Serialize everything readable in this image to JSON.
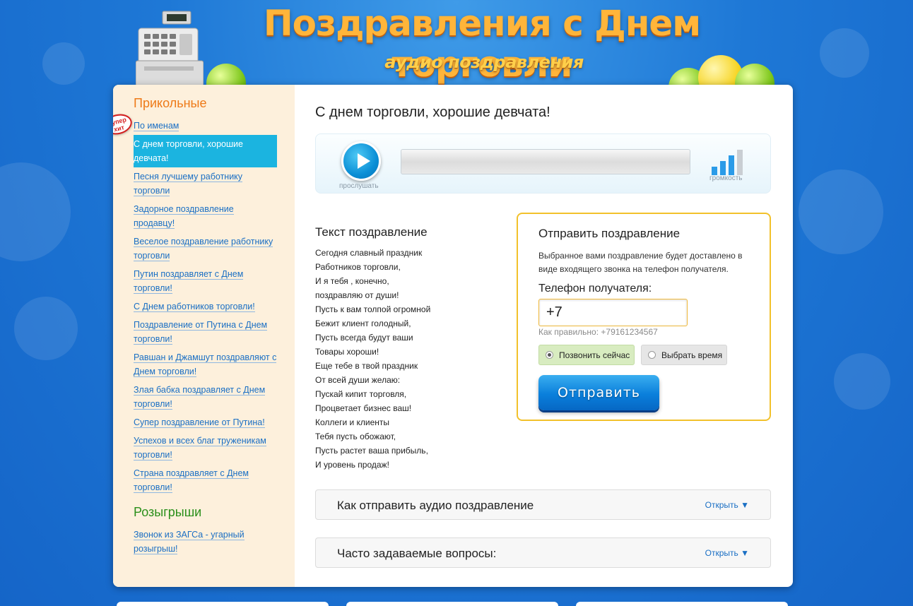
{
  "header": {
    "title": "Поздравления с Днем торговли",
    "subtitle": "аудио поздравления"
  },
  "sidebar": {
    "badge": "супер хит",
    "section1_title": "Прикольные",
    "items": [
      {
        "label": "По именам"
      },
      {
        "label": "С днем торговли, хорошие девчата!",
        "active": true
      },
      {
        "label": "Песня лучшему работнику торговли"
      },
      {
        "label": "Задорное поздравление продавцу!"
      },
      {
        "label": "Веселое поздравление работнику торговли"
      },
      {
        "label": "Путин поздравляет с Днем торговли!"
      },
      {
        "label": "С Днем работников торговли!"
      },
      {
        "label": "Поздравление от Путина с Днем торговли!"
      },
      {
        "label": "Равшан и Джамшут поздравляют с Днем торговли!"
      },
      {
        "label": "Злая бабка поздравляет с Днем торговли!"
      },
      {
        "label": "Супер поздравление от Путина!"
      },
      {
        "label": "Успехов и всех благ труженикам торговли!"
      },
      {
        "label": "Страна поздравляет с Днем торговли!"
      }
    ],
    "section2_title": "Розыгрыши",
    "items2": [
      {
        "label": "Звонок из ЗАГСа - угарный розыгрыш!"
      }
    ]
  },
  "main": {
    "title": "С днем торговли, хорошие девчата!",
    "player": {
      "play_label": "прослушать",
      "volume_label": "громкость",
      "progress": 0,
      "volume_level": 3,
      "volume_max": 4
    },
    "text_heading": "Текст поздравление",
    "poem": [
      "Сегодня славный праздник",
      "Работников торговли,",
      "И я тебя , конечно,",
      "поздравляю от души!",
      "Пусть к вам толпой огромной",
      "Бежит клиент голодный,",
      "Пусть всегда будут ваши",
      "Товары хороши!",
      "Еще тебе в твой праздник",
      "От всей души желаю:",
      "Пускай кипит торговля,",
      "Процветает бизнес ваш!",
      "Коллеги и клиенты",
      "Тебя пусть обожают,",
      "Пусть растет ваша прибыль,",
      "И уровень продаж!"
    ],
    "send": {
      "title": "Отправить поздравление",
      "description": "Выбранное вами поздравление будет доставлено в виде входящего звонка на телефон получателя.",
      "phone_label": "Телефон получателя:",
      "phone_value": "+7",
      "phone_hint": "Как правильно: +79161234567",
      "option_now": "Позвонить сейчас",
      "option_time": "Выбрать время",
      "selected_option": "now",
      "button": "Отправить"
    },
    "accordion": [
      {
        "title": "Как отправить аудио поздравление",
        "action": "Открыть ▼"
      },
      {
        "title": "Часто задаваемые вопросы:",
        "action": "Открыть ▼"
      }
    ]
  },
  "colors": {
    "background": "#1e78d6",
    "active_item": "#1bb4e0",
    "sidebar_bg": "#fdf0dc",
    "accent_orange": "#ee7a18",
    "accent_green": "#2a8f1a",
    "link": "#1a6fc4",
    "send_border": "#f2c12b"
  }
}
